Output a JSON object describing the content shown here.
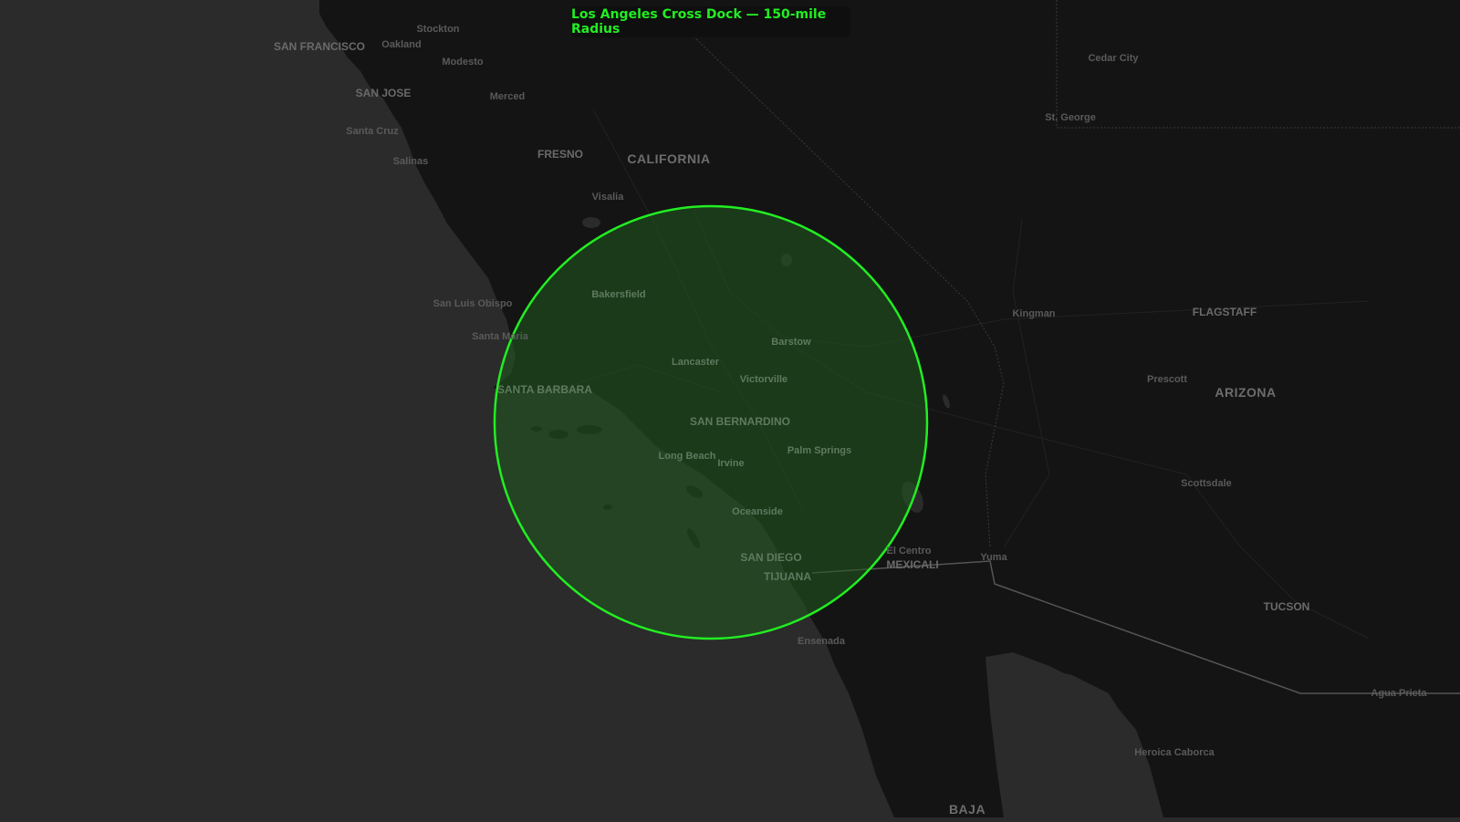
{
  "title": "Los Angeles Cross Dock — 150-mile Radius",
  "colors": {
    "ocean": "#2b2b2b",
    "land": "#141414",
    "radius_stroke": "#22ee22",
    "radius_fill": "#1f5a1f"
  },
  "radius": {
    "center": "Los Angeles Cross Dock",
    "miles": 150
  },
  "regions": [
    "CALIFORNIA",
    "ARIZONA",
    "BAJA"
  ],
  "cities": [
    "SAN FRANCISCO",
    "Oakland",
    "Stockton",
    "Modesto",
    "SAN JOSE",
    "Merced",
    "Santa Cruz",
    "Salinas",
    "FRESNO",
    "Visalia",
    "Bakersfield",
    "San Luis Obispo",
    "Santa Maria",
    "Lancaster",
    "Victorville",
    "Barstow",
    "SANTA BARBARA",
    "SAN BERNARDINO",
    "Long Beach",
    "Irvine",
    "Palm Springs",
    "Oceanside",
    "SAN DIEGO",
    "TIJUANA",
    "El Centro",
    "MEXICALI",
    "Yuma",
    "Ensenada",
    "Cedar City",
    "St. George",
    "Kingman",
    "FLAGSTAFF",
    "Prescott",
    "Scottsdale",
    "TUCSON",
    "Agua Prieta",
    "Heroica Caborca"
  ]
}
